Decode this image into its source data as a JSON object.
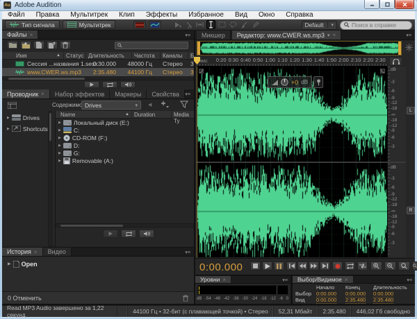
{
  "window": {
    "icon_label": "Au",
    "title": "Adobe Audition"
  },
  "menu_bar": {
    "items": [
      "Файл",
      "Правка",
      "Мультитрек",
      "Клип",
      "Эффекты",
      "Избранное",
      "Вид",
      "Окно",
      "Справка"
    ]
  },
  "toolbar": {
    "waveform_button": "Тип сигнала",
    "multitrack_button": "Мультитрек",
    "workspace_value": "Default",
    "help_search_placeholder": "Поиск в справке"
  },
  "files_panel": {
    "tab": "Файлы",
    "columns": {
      "name": "Имя",
      "status": "Статус",
      "duration": "Длительность",
      "rate": "Частота",
      "channels": "Каналы",
      "bits": "Б"
    },
    "rows": [
      {
        "name": "Сессия ...названия 1.sesx",
        "duration": "0:30.000",
        "rate": "48000 Гц",
        "channels": "Стерео",
        "bits": "3"
      },
      {
        "name": "www.CWER.ws.mp3",
        "duration": "2:35.480",
        "rate": "44100 Гц",
        "channels": "Стерео",
        "bits": "3"
      }
    ]
  },
  "browser_panel": {
    "tabs": [
      "Проводник",
      "Набор эффектов",
      "Маркеры",
      "Свойства"
    ],
    "content_label": "Содержимое:",
    "content_value": "Drives",
    "tree": [
      "Drives",
      "Shortcuts"
    ],
    "columns": {
      "name": "Name",
      "duration": "Duration",
      "media": "Media Ty"
    },
    "items": [
      {
        "label": "Локальный диск (E:)",
        "icon": "drive-icon"
      },
      {
        "label": "C:",
        "icon": "system-drive-icon"
      },
      {
        "label": "CD-ROM (F:)",
        "icon": "cd-rom-icon"
      },
      {
        "label": "D:",
        "icon": "drive-icon"
      },
      {
        "label": "G:",
        "icon": "drive-icon"
      },
      {
        "label": "Removable (A:)",
        "icon": "floppy-icon"
      }
    ]
  },
  "history_panel": {
    "tabs": [
      "История",
      "Видео"
    ],
    "entries": [
      "Open"
    ],
    "undo_status": "0 Отменить"
  },
  "editor_panel": {
    "mixer_tab": "Микшер",
    "editor_tab": "Редактор: www.CWER.ws.mp3",
    "ruler_unit": "чмс",
    "ruler_ticks": [
      "0:20",
      "0:30",
      "0:40",
      "0:50",
      "1:00",
      "1:10",
      "1:20",
      "1:30",
      "1:40",
      "1:50",
      "2:00",
      "2:10",
      "2:20",
      "2:30"
    ],
    "duration_seconds": 155.48,
    "db_top_label": "dB",
    "db_labels": [
      "-3",
      "-6",
      "-9",
      "-12",
      "-18"
    ],
    "db_inf_label": "-∞",
    "channel_badges": [
      "L",
      "R"
    ],
    "hud_gain": "+0",
    "hud_unit": "dB",
    "time_display": "0:00.000"
  },
  "levels_panel": {
    "tab": "Уровни",
    "scale": [
      "dB",
      "-54",
      "-48",
      "-42",
      "-36",
      "-30",
      "-24",
      "-18",
      "-12",
      "-6",
      "0"
    ]
  },
  "selection_panel": {
    "tab": "Выбор/Видимое",
    "columns": [
      "Начало",
      "Конец",
      "Длительность"
    ],
    "rows": [
      {
        "label": "Выбор",
        "values": [
          "0:00.000",
          "0:00.000",
          "0:00.000"
        ]
      },
      {
        "label": "Вид",
        "values": [
          "0:00.000",
          "2:35.480",
          "2:35.480"
        ]
      }
    ]
  },
  "status_bar": {
    "message": "Read MP3 Audio завершено за 1,22 секунд",
    "format": "44100 Гц • 32-бит (с плавающей точкой) • Стерео",
    "size": "52,31 Мбайт",
    "duration": "2:35.480",
    "free": "446,02 Гб свободно"
  },
  "colors": {
    "accent_orange": "#d79d3c",
    "wave_green": "#4fd391",
    "record_red": "#cf3a2e",
    "selection_handle": "#d9a43c"
  },
  "icons": {
    "panel_menu": "▾≡",
    "close": "×",
    "caret_down": "▾",
    "disclosure": "▶",
    "sort_asc": "▲",
    "back": "◀"
  }
}
